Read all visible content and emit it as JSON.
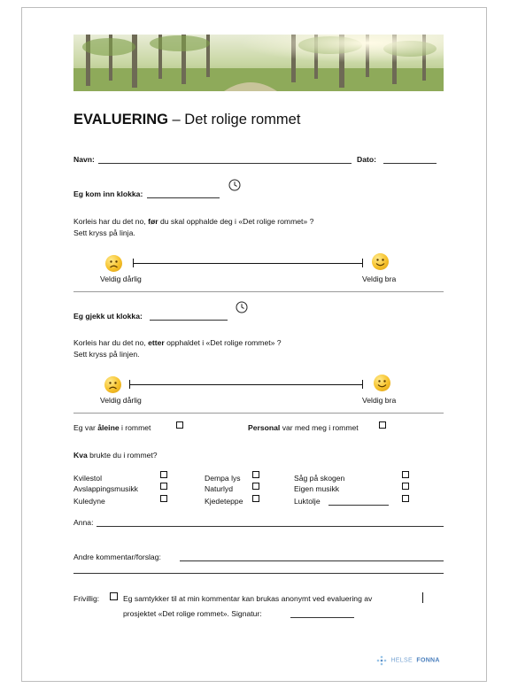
{
  "title": {
    "bold": "EVALUERING",
    "rest": " – Det rolige rommet"
  },
  "name_label": "Navn:",
  "date_label": "Dato:",
  "arrival_label": "Eg kom inn klokka:",
  "before": {
    "q_pre": "Korleis har du det no, ",
    "q_bold": "før",
    "q_post": " du skal opphalde deg i «Det rolige rommet» ?",
    "instruction": "Sett kryss på linja.",
    "low_label": "Veldig dårlig",
    "high_label": "Veldig bra"
  },
  "departure_label": "Eg gjekk ut klokka:",
  "after": {
    "q_pre": "Korleis har du det no, ",
    "q_bold": "etter",
    "q_post": " opphaldet i «Det rolige rommet» ?",
    "instruction": "Sett kryss på linjen.",
    "low_label": "Veldig dårlig",
    "high_label": "Veldig bra"
  },
  "alone": {
    "pre": "Eg var ",
    "bold": "åleine",
    "post": " i rommet"
  },
  "staff": {
    "bold": "Personal",
    "post": " var med meg i rommet"
  },
  "used": {
    "bold": "Kva",
    "post": " brukte du i rommet?"
  },
  "options": {
    "kvilestol": "Kvilestol",
    "avslapping": "Avslappingsmusikk",
    "kuledyne": "Kuledyne",
    "dempa": "Dempa lys",
    "naturlyd": "Naturlyd",
    "kjedeteppe": "Kjedeteppe",
    "sag": "Såg på skogen",
    "eigen": "Eigen musikk",
    "luktolje": "Luktolje"
  },
  "other_label": "Anna:",
  "comments_label": "Andre kommentar/forslag:",
  "voluntary": {
    "label": "Frivillig:",
    "line1": "Eg samtykker til at min kommentar kan brukas anonymt ved evaluering av",
    "line2": "prosjektet «Det rolige rommet». Signatur:"
  },
  "logo": {
    "word1": "HELSE",
    "word2": "FONNA"
  },
  "icons": {
    "banner": "forest-photo",
    "clock": "clock-icon",
    "sad": "sad-face-icon",
    "happy": "happy-face-icon"
  }
}
